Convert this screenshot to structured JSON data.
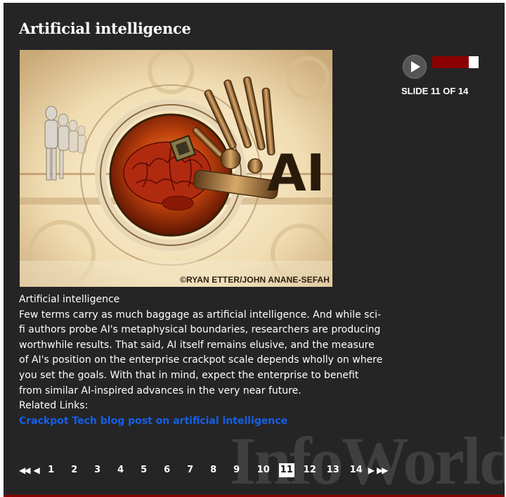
{
  "title": "Artificial intelligence",
  "image": {
    "alt": "Artificial intelligence",
    "logo_text": "AI",
    "credit": "©RYAN ETTER/JOHN ANANE-SEFAH"
  },
  "player": {
    "play_icon": "play-icon",
    "progress_fraction": 0.786,
    "progress_color": "#8b0000",
    "counter": "SLIDE 11 OF 14"
  },
  "caption": {
    "heading": "Artificial intelligence",
    "body": "Few terms carry as much baggage as artificial intelligence. And while sci-fi authors probe AI's metaphysical boundaries, researchers are producing worthwhile results. That said, AI itself remains elusive, and the measure of AI's position on the enterprise crackpot scale depends wholly on where you set the goals. With that in mind, expect the enterprise to benefit from similar AI-inspired advances in the very near future.",
    "related_label": "Related Links:",
    "related_link": "Crackpot Tech blog post on artificial intelligence"
  },
  "pager": {
    "first": "◀◀",
    "prev": "◀",
    "next": "▶",
    "last": "▶▶",
    "pages": [
      "1",
      "2",
      "3",
      "4",
      "5",
      "6",
      "7",
      "8",
      "9",
      "10",
      "11",
      "12",
      "13",
      "14"
    ],
    "current": "11"
  },
  "watermark": "InfoWorld",
  "colors": {
    "background": "#252525",
    "accent_red": "#8b0000",
    "link_blue": "#1560e8"
  }
}
